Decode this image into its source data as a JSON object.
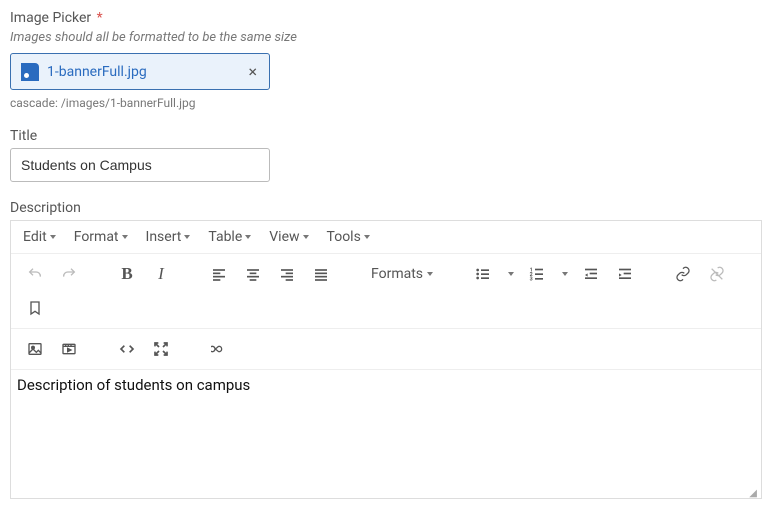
{
  "imagePicker": {
    "label": "Image Picker",
    "requiredMark": "*",
    "helper": "Images should all be formatted to be the same size",
    "selectedFile": "1-bannerFull.jpg",
    "closeGlyph": "×",
    "path": "cascade: /images/1-bannerFull.jpg"
  },
  "titleField": {
    "label": "Title",
    "value": "Students on Campus"
  },
  "descriptionField": {
    "label": "Description"
  },
  "editor": {
    "menus": {
      "edit": "Edit",
      "format": "Format",
      "insert": "Insert",
      "table": "Table",
      "view": "View",
      "tools": "Tools"
    },
    "formatsLabel": "Formats",
    "content": "Description of students on campus"
  }
}
